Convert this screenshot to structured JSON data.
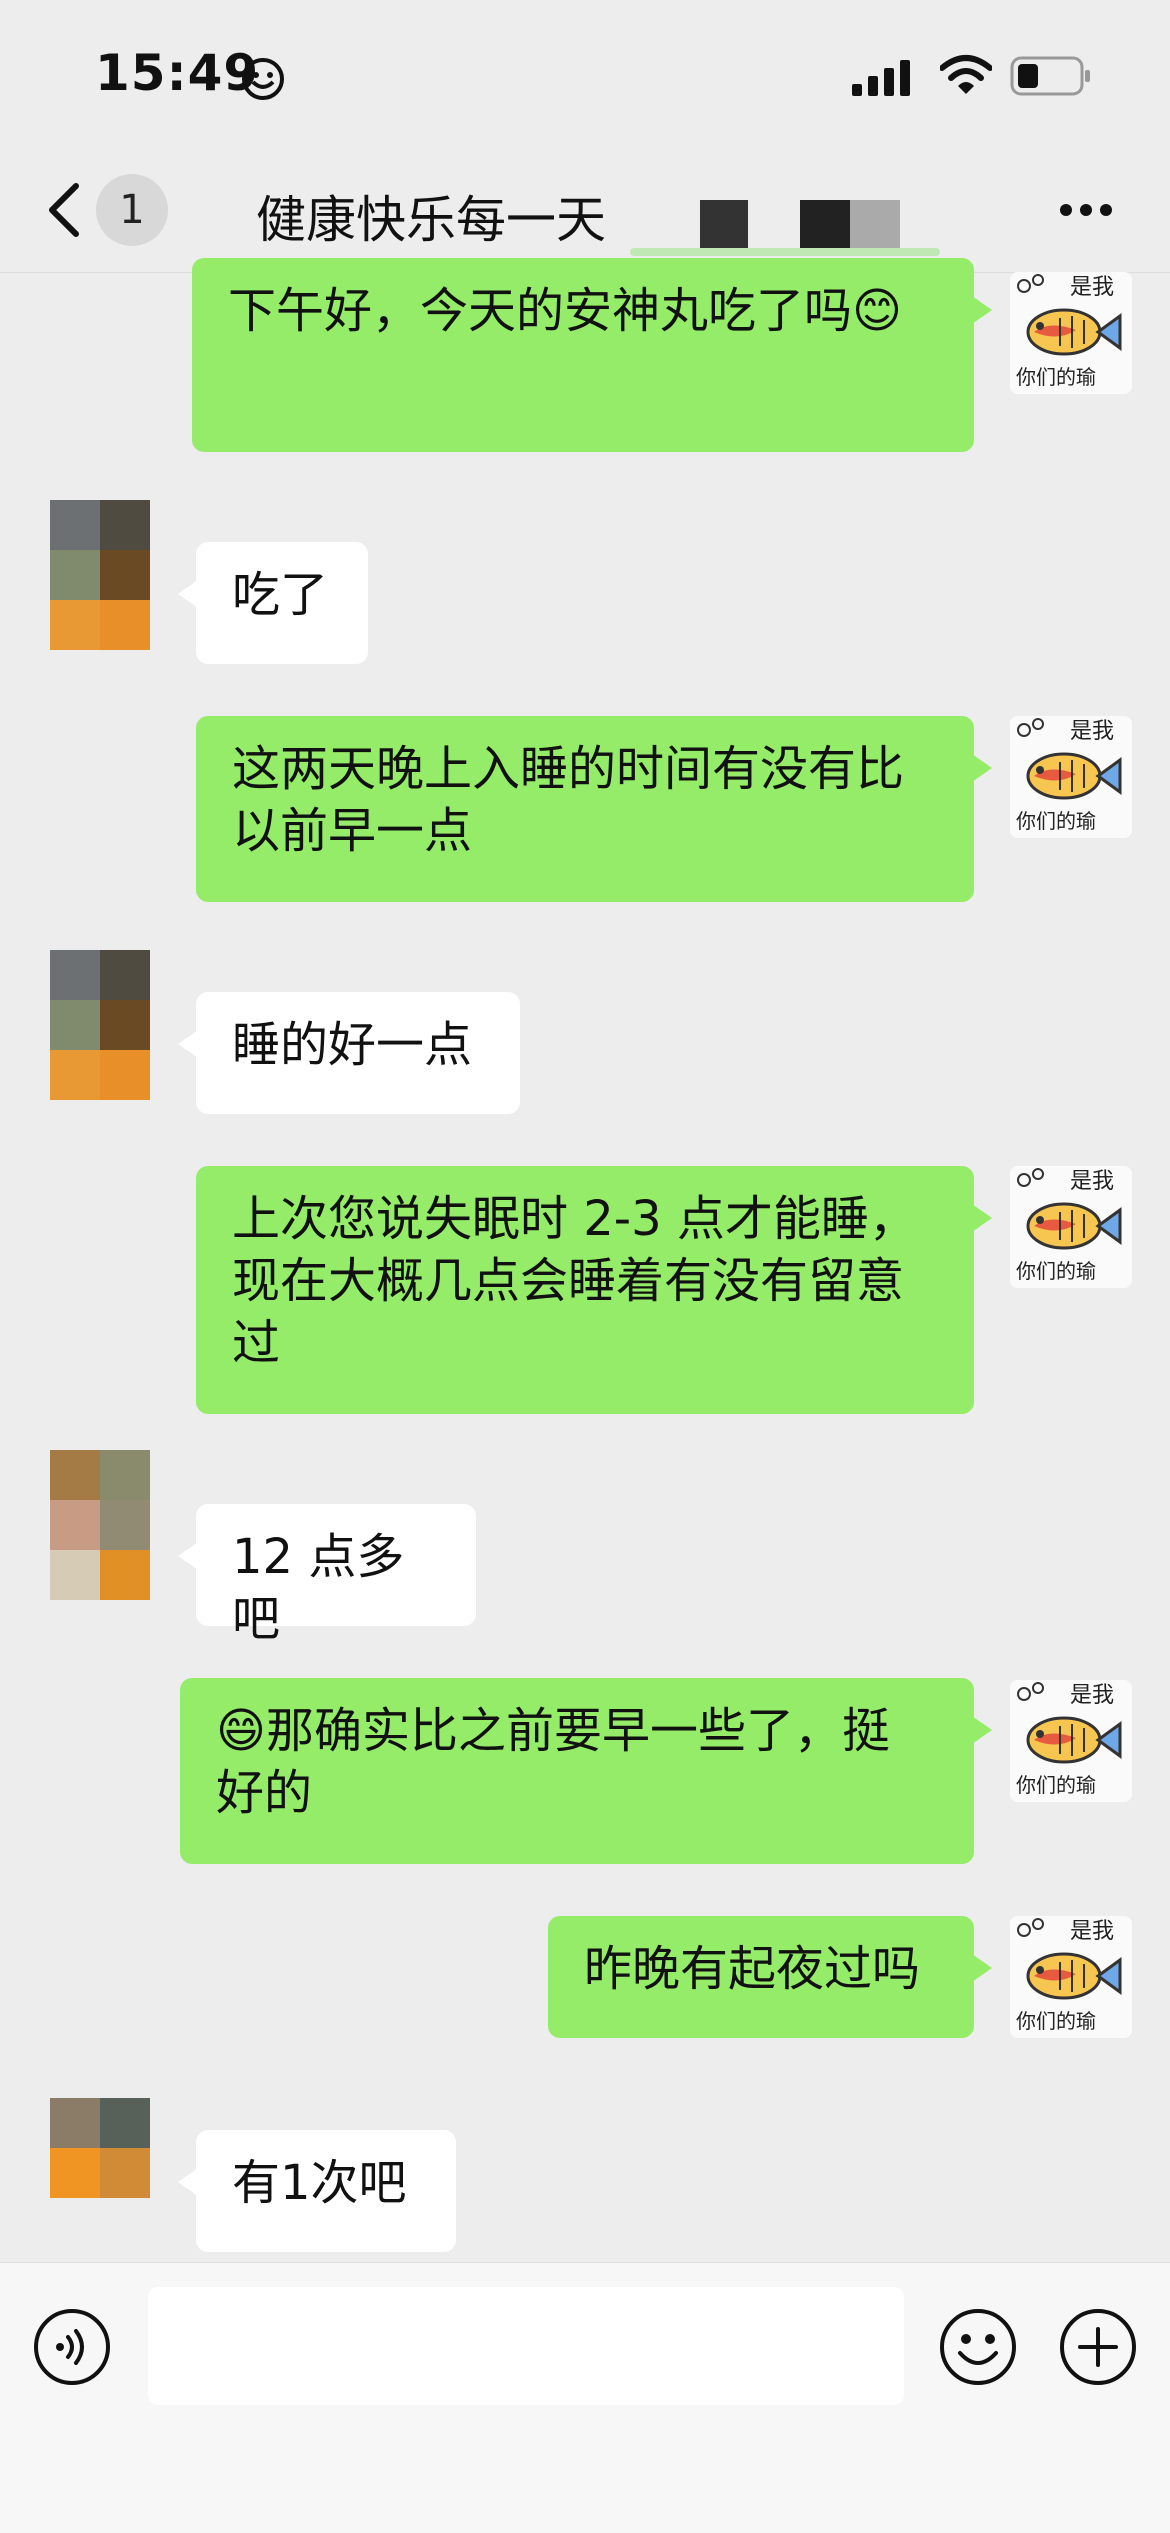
{
  "status": {
    "time": "15:49"
  },
  "nav": {
    "back_count": "1",
    "title": "健康快乐每一天"
  },
  "messages": [
    {
      "side": "out",
      "text": "下午好，今天的安神丸吃了吗😊"
    },
    {
      "side": "in",
      "text": "吃了"
    },
    {
      "side": "out",
      "text": "这两天晚上入睡的时间有没有比以前早一点"
    },
    {
      "side": "in",
      "text": "睡的好一点"
    },
    {
      "side": "out",
      "text": "上次您说失眠时 2-3 点才能睡，现在大概几点会睡着有没有留意过"
    },
    {
      "side": "in",
      "text": "12 点多吧"
    },
    {
      "side": "out",
      "text": "😄那确实比之前要早一些了，挺好的"
    },
    {
      "side": "out",
      "text": "昨晚有起夜过吗"
    },
    {
      "side": "in",
      "text": "有1次吧"
    }
  ],
  "self_avatar": {
    "caption_top": "是我",
    "caption_bottom": "你们的瑜"
  },
  "input": {
    "placeholder": ""
  },
  "colors": {
    "out_bubble": "#95ec69",
    "in_bubble": "#ffffff",
    "background": "#ededed"
  },
  "icons": [
    "smiley-icon",
    "signal-icon",
    "wifi-icon",
    "battery-icon",
    "back-chevron-icon",
    "more-dots-icon",
    "voice-icon",
    "emoji-icon",
    "plus-icon"
  ]
}
